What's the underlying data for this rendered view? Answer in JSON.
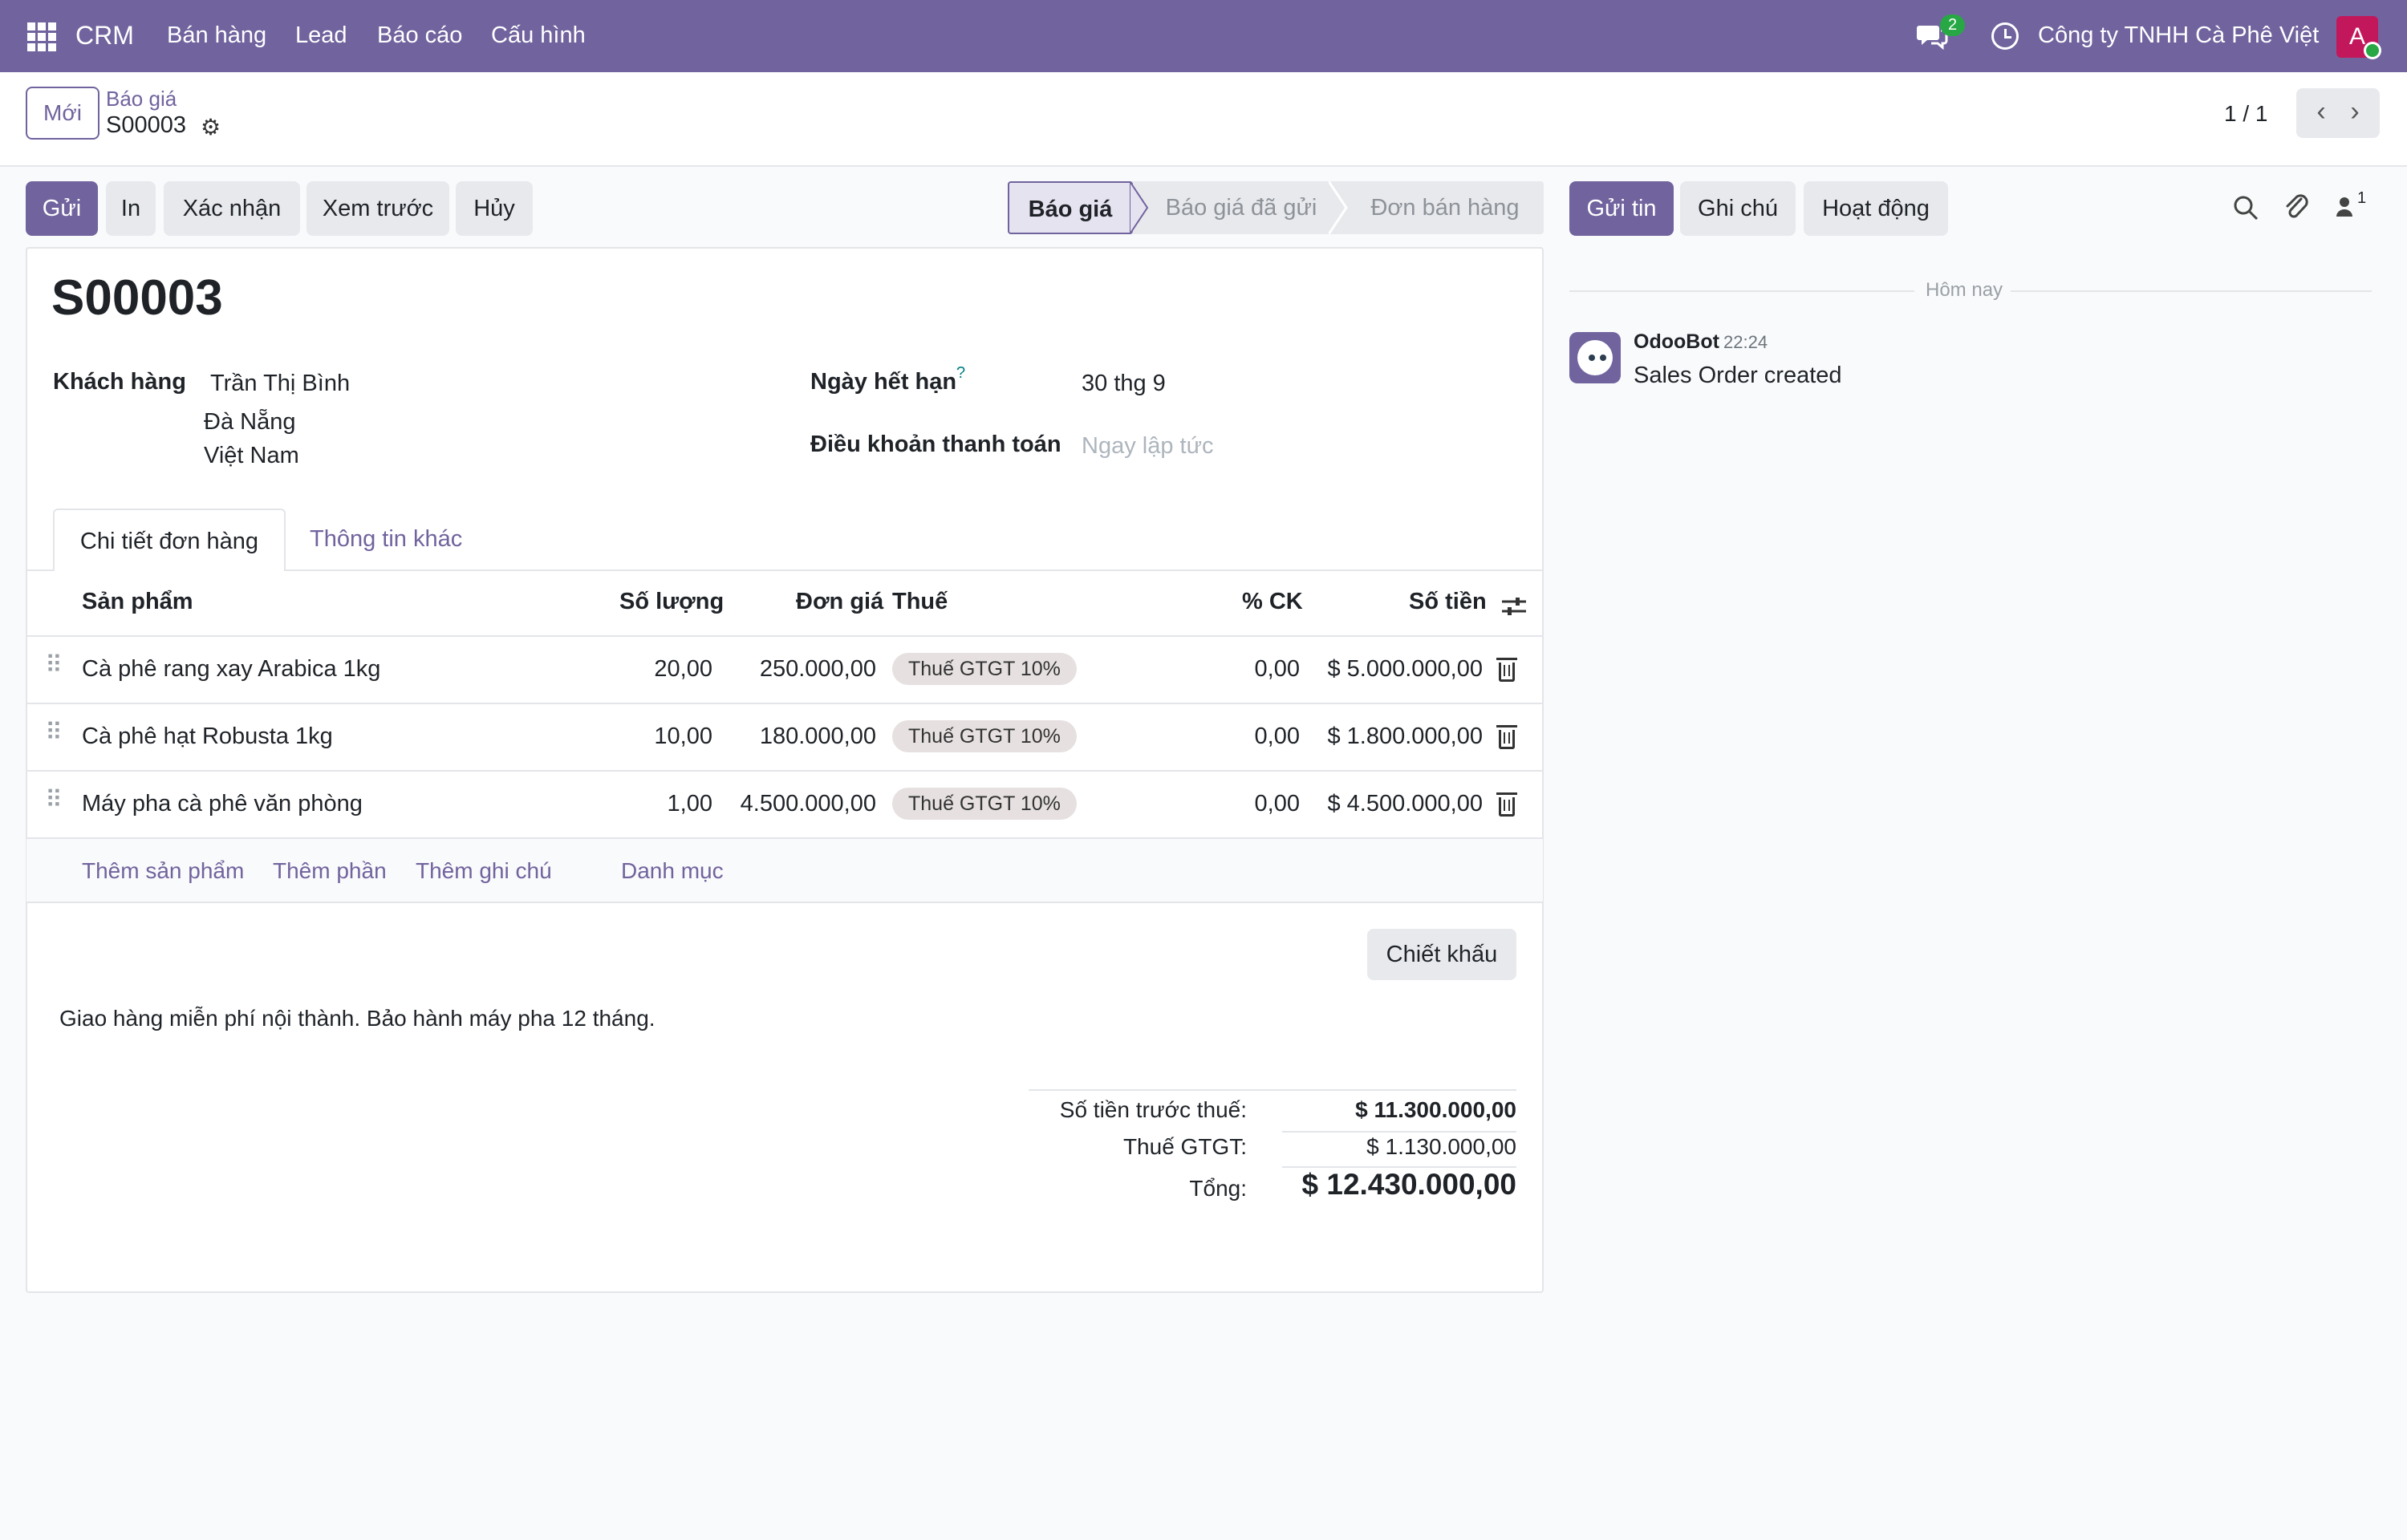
{
  "navbar": {
    "brand": "CRM",
    "menu": [
      "Bán hàng",
      "Lead",
      "Báo cáo",
      "Cấu hình"
    ],
    "chat_count": "2",
    "company": "Công ty TNHH Cà Phê Việt",
    "avatar_letter": "A"
  },
  "control": {
    "new_label": "Mới",
    "breadcrumb": "Báo giá",
    "record_name": "S00003",
    "pager": "1 / 1"
  },
  "actions": [
    "Gửi",
    "In",
    "Xác nhận",
    "Xem trước",
    "Hủy"
  ],
  "status": {
    "steps": [
      "Báo giá",
      "Báo giá đã gửi",
      "Đơn bán hàng"
    ],
    "active": "Báo giá"
  },
  "form": {
    "title": "S00003",
    "customer_label": "Khách hàng",
    "customer_name": "Trần Thị Bình",
    "customer_city": "Đà Nẵng",
    "customer_country": "Việt Nam",
    "expiry_label": "Ngày hết hạn",
    "expiry_help": "?",
    "expiry_value": "30 thg 9",
    "terms_label": "Điều khoản thanh toán",
    "terms_placeholder": "Ngay lập tức",
    "tabs": [
      "Chi tiết đơn hàng",
      "Thông tin khác"
    ],
    "columns": [
      "Sản phẩm",
      "Số lượng",
      "Đơn giá",
      "Thuế",
      "% CK",
      "Số tiền"
    ],
    "lines": [
      {
        "product": "Cà phê rang xay Arabica 1kg",
        "qty": "20,00",
        "price": "250.000,00",
        "tax": "Thuế GTGT 10%",
        "disc": "0,00",
        "amount": "$ 5.000.000,00"
      },
      {
        "product": "Cà phê hạt Robusta 1kg",
        "qty": "10,00",
        "price": "180.000,00",
        "tax": "Thuế GTGT 10%",
        "disc": "0,00",
        "amount": "$ 1.800.000,00"
      },
      {
        "product": "Máy pha cà phê văn phòng",
        "qty": "1,00",
        "price": "4.500.000,00",
        "tax": "Thuế GTGT 10%",
        "disc": "0,00",
        "amount": "$ 4.500.000,00"
      }
    ],
    "add_links": [
      "Thêm sản phẩm",
      "Thêm phần",
      "Thêm ghi chú",
      "Danh mục"
    ],
    "discount_label": "Chiết khấu",
    "note": "Giao hàng miễn phí nội thành. Bảo hành máy pha 12 tháng.",
    "totals": {
      "untaxed_label": "Số tiền trước thuế:",
      "untaxed_value": "$ 11.300.000,00",
      "tax_label": "Thuế GTGT:",
      "tax_value": "$ 1.130.000,00",
      "total_label": "Tổng:",
      "total_value": "$ 12.430.000,00"
    }
  },
  "chatter": {
    "buttons": [
      "Gửi tin",
      "Ghi chú",
      "Hoạt động"
    ],
    "followers_count": "1",
    "today_label": "Hôm nay",
    "message": {
      "author": "OdooBot",
      "time": "22:24",
      "body": "Sales Order created"
    }
  },
  "colors": {
    "brand": "#71639e",
    "online": "#28a745",
    "avatar": "#c2185b"
  }
}
